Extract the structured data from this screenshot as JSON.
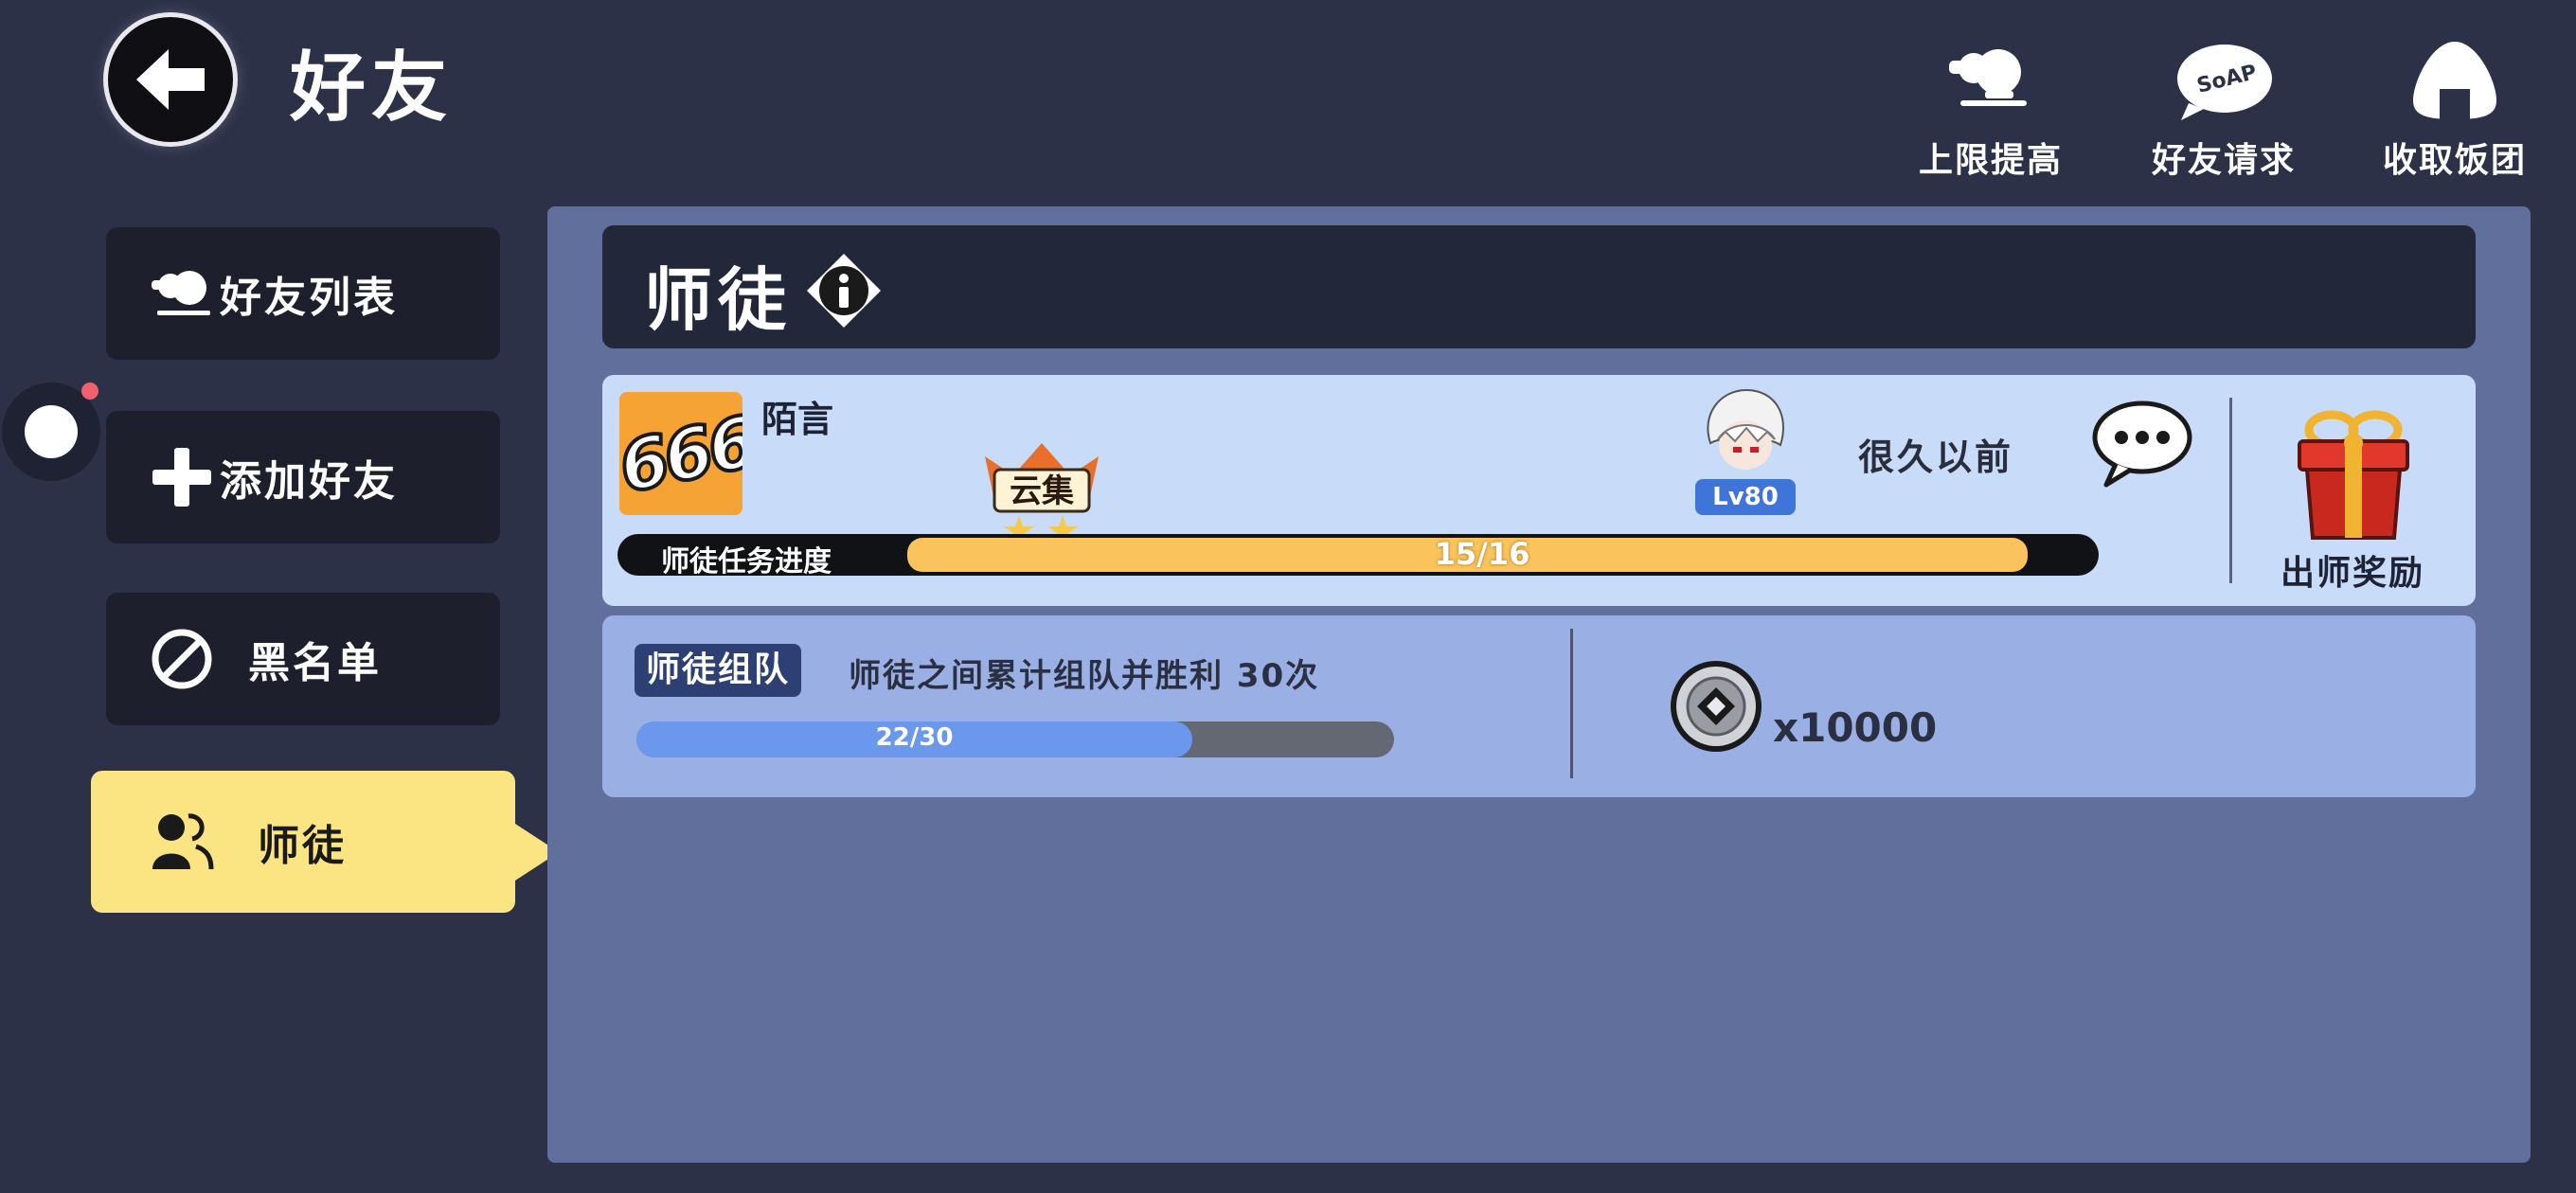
{
  "header": {
    "title": "好友"
  },
  "top_actions": [
    {
      "label": "上限提高",
      "icon": "raise-limit-icon"
    },
    {
      "label": "好友请求",
      "icon": "soap-bubble-icon"
    },
    {
      "label": "收取饭团",
      "icon": "rice-ball-icon"
    }
  ],
  "sidebar": {
    "items": [
      {
        "label": "好友列表",
        "icon": "friends-icon",
        "active": false
      },
      {
        "label": "添加好友",
        "icon": "plus-icon",
        "active": false
      },
      {
        "label": "黑名单",
        "icon": "blocked-icon",
        "active": false
      },
      {
        "label": "师徒",
        "icon": "mentor-icon",
        "active": true
      }
    ]
  },
  "section": {
    "title": "师徒",
    "info_icon": "info-icon"
  },
  "mentor_card": {
    "avatar_text": "666",
    "player_name": "陌言",
    "title_badge_text": "云集",
    "partner_level": "Lv80",
    "last_online": "很久以前",
    "progress_label": "师徒任务进度",
    "progress_text": "15/16",
    "progress_current": 15,
    "progress_total": 16,
    "graduation_label": "出师奖励"
  },
  "task": {
    "tag": "师徒组队",
    "description": "师徒之间累计组队并胜利 30次",
    "progress_text": "22/30",
    "progress_current": 22,
    "progress_total": 30,
    "reward_amount": "x10000",
    "reward_icon": "coin-icon"
  },
  "colors": {
    "background": "#2d3148",
    "panel": "#606f9c",
    "active_tab": "#fbe583",
    "progress_fill": "#fbc35b",
    "task_fill": "#6b97ec"
  }
}
